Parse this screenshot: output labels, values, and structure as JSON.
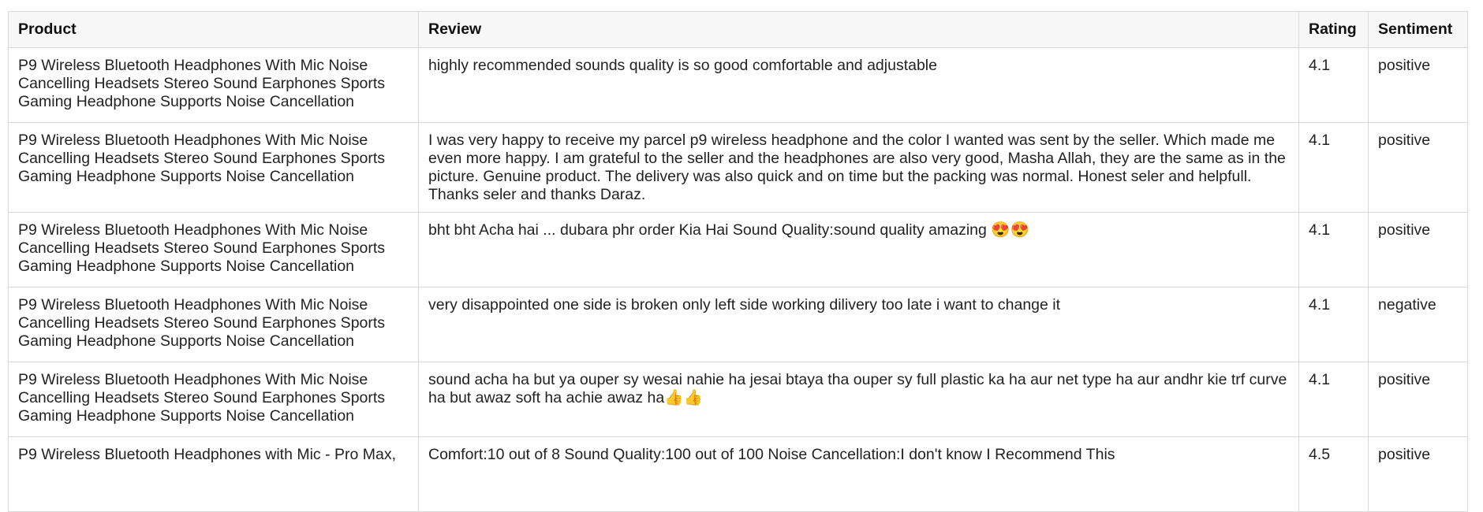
{
  "table": {
    "headers": {
      "product": "Product",
      "review": "Review",
      "rating": "Rating",
      "sentiment": "Sentiment"
    },
    "rows": [
      {
        "product": "P9 Wireless Bluetooth Headphones With Mic Noise Cancelling Headsets Stereo Sound Earphones Sports Gaming Headphone Supports Noise Cancellation",
        "review": "highly recommended sounds quality is so good comfortable and adjustable",
        "rating": "4.1",
        "sentiment": "positive"
      },
      {
        "product": "P9 Wireless Bluetooth Headphones With Mic Noise Cancelling Headsets Stereo Sound Earphones Sports Gaming Headphone Supports Noise Cancellation",
        "review": "I was very happy to receive my parcel p9 wireless headphone and the color I wanted was sent by the seller. Which made me even more happy. I am grateful to the seller and the headphones are also very good, Masha Allah, they are the same as in the picture. Genuine product. The delivery was also quick and on time but the packing was normal. Honest seler and helpfull. Thanks seler and thanks Daraz.",
        "rating": "4.1",
        "sentiment": "positive"
      },
      {
        "product": "P9 Wireless Bluetooth Headphones With Mic Noise Cancelling Headsets Stereo Sound Earphones Sports Gaming Headphone Supports Noise Cancellation",
        "review": "bht bht Acha hai ... dubara phr order Kia Hai Sound Quality:sound quality amazing 😍😍",
        "rating": "4.1",
        "sentiment": "positive"
      },
      {
        "product": "P9 Wireless Bluetooth Headphones With Mic Noise Cancelling Headsets Stereo Sound Earphones Sports Gaming Headphone Supports Noise Cancellation",
        "review": "very disappointed one side is broken only left side working dilivery too late i want to change it",
        "rating": "4.1",
        "sentiment": "negative"
      },
      {
        "product": "P9 Wireless Bluetooth Headphones With Mic Noise Cancelling Headsets Stereo Sound Earphones Sports Gaming Headphone Supports Noise Cancellation",
        "review": "sound acha ha but ya ouper sy wesai nahie ha jesai btaya tha ouper sy full plastic ka ha aur net type ha aur andhr kie trf curve ha but awaz soft ha achie awaz ha👍👍",
        "rating": "4.1",
        "sentiment": "positive"
      },
      {
        "product": "P9 Wireless Bluetooth Headphones with Mic - Pro Max,",
        "review": "Comfort:10 out of 8 Sound Quality:100 out of 100 Noise Cancellation:I don't know I Recommend This",
        "rating": "4.5",
        "sentiment": "positive"
      }
    ]
  }
}
